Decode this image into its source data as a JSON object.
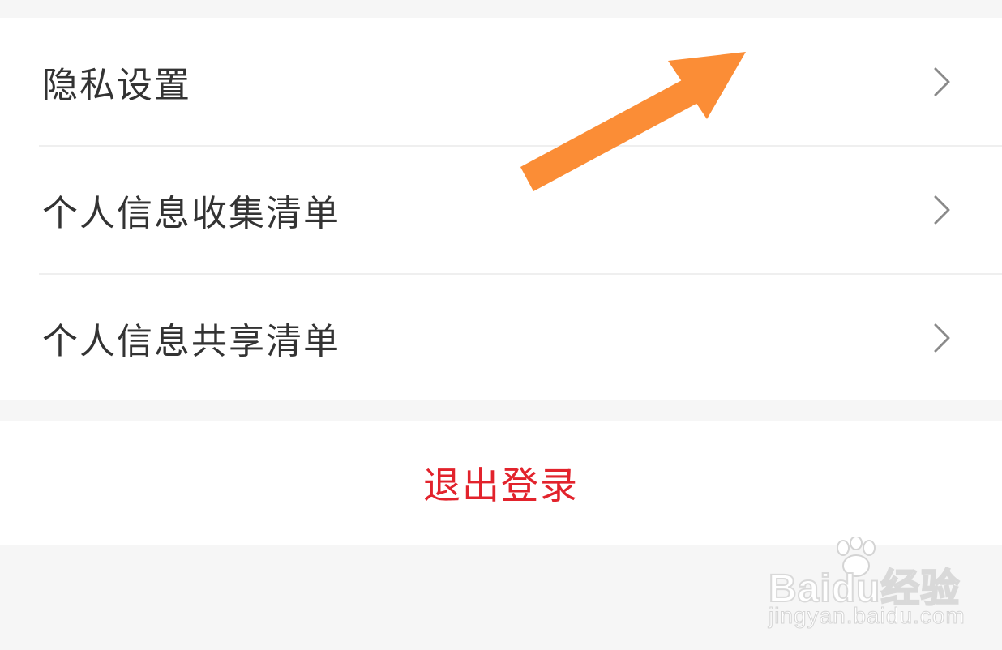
{
  "menu": {
    "items": [
      {
        "label": "隐私设置",
        "chevron": "chevron-right-icon"
      },
      {
        "label": "个人信息收集清单",
        "chevron": "chevron-right-icon"
      },
      {
        "label": "个人信息共享清单",
        "chevron": "chevron-right-icon"
      }
    ]
  },
  "logout": {
    "label": "退出登录",
    "color": "#e2232c"
  },
  "annotation": {
    "icon": "arrow-pointer-icon",
    "color": "#fb8d36"
  },
  "watermark": {
    "brand": "Baidu经验",
    "url": "jingyan.baidu.com",
    "icon": "paw-icon"
  },
  "colors": {
    "background": "#f6f6f6",
    "panel": "#ffffff",
    "text": "#333333",
    "chevron": "#8a8a8a",
    "divider": "#efefef"
  }
}
